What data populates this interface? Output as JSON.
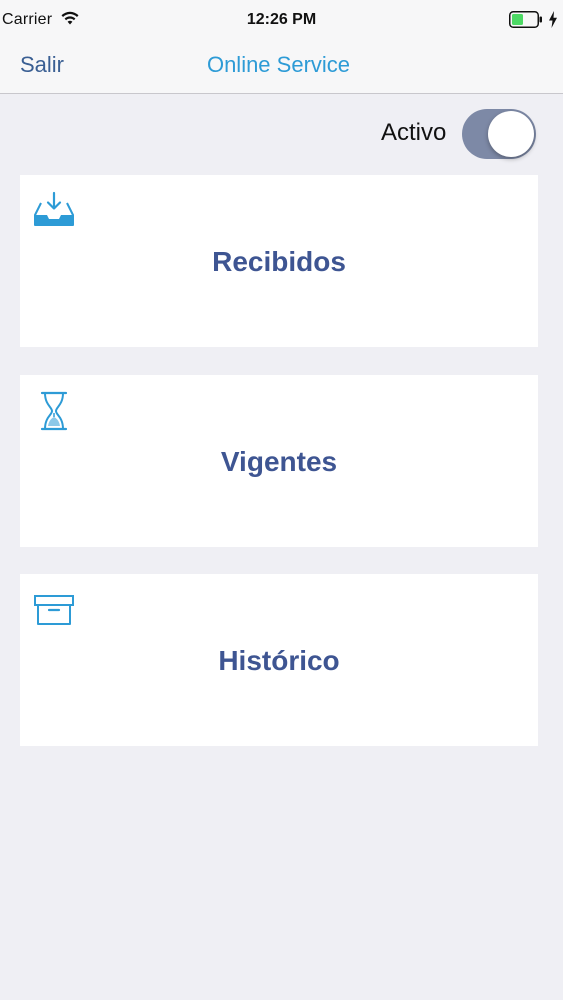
{
  "status_bar": {
    "carrier": "Carrier",
    "time": "12:26 PM",
    "battery_color": "#4cd964"
  },
  "nav": {
    "back_label": "Salir",
    "title": "Online Service",
    "title_color": "#2d9bd6"
  },
  "toggle": {
    "label": "Activo",
    "on": true,
    "track_color": "#7d89a6"
  },
  "cards": [
    {
      "label": "Recibidos",
      "icon": "inbox-download-icon"
    },
    {
      "label": "Vigentes",
      "icon": "hourglass-icon"
    },
    {
      "label": "Histórico",
      "icon": "archive-box-icon"
    }
  ],
  "colors": {
    "card_text": "#3e5592",
    "icon": "#2d9bd6",
    "background": "#efeff4"
  }
}
